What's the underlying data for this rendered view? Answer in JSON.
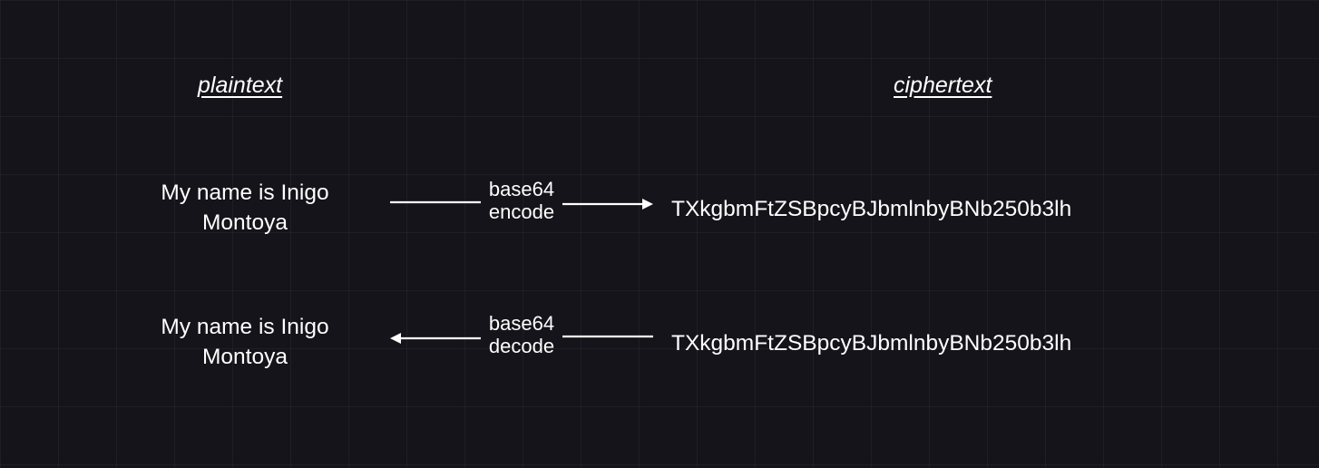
{
  "headers": {
    "plaintext": "plaintext",
    "ciphertext": "ciphertext"
  },
  "rows": [
    {
      "plaintext": "My name is Inigo\nMontoya",
      "op_line1": "base64",
      "op_line2": "encode",
      "direction": "right",
      "ciphertext": "TXkgbmFtZSBpcyBJbmlnbyBNb250b3lh"
    },
    {
      "plaintext": "My name is Inigo\nMontoya",
      "op_line1": "base64",
      "op_line2": "decode",
      "direction": "left",
      "ciphertext": "TXkgbmFtZSBpcyBJbmlnbyBNb250b3lh"
    }
  ]
}
